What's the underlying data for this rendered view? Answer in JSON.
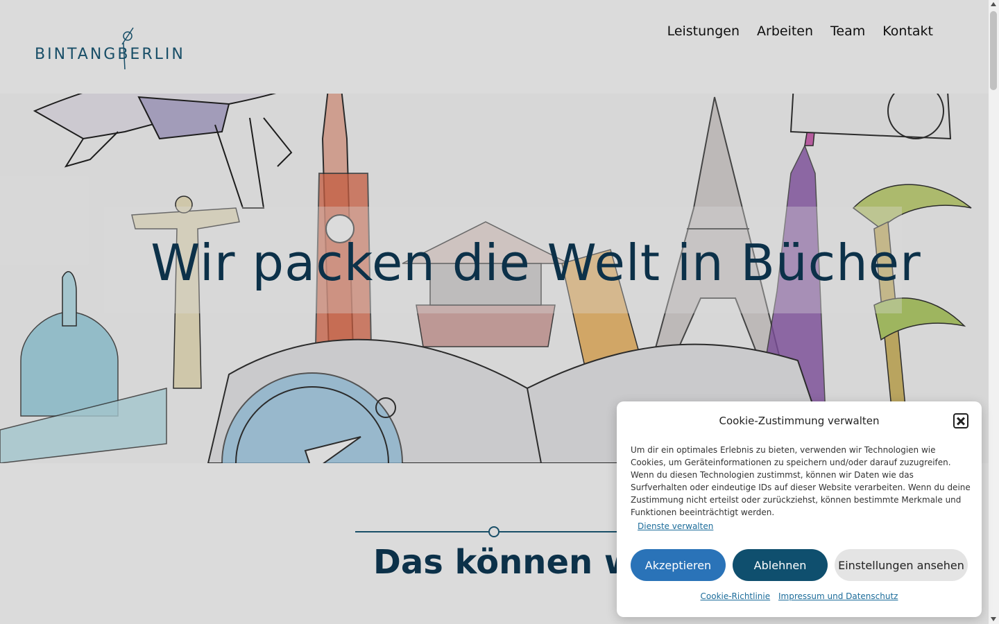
{
  "brand": {
    "part1": "BINTANG",
    "part2": "BERLIN"
  },
  "nav": [
    {
      "label": "Leistungen"
    },
    {
      "label": "Arbeiten"
    },
    {
      "label": "Team"
    },
    {
      "label": "Kontakt"
    }
  ],
  "hero": {
    "title": "Wir packen die Welt in Bücher"
  },
  "section": {
    "title": "Das können wir"
  },
  "cookie": {
    "title": "Cookie-Zustimmung verwalten",
    "text": "Um dir ein optimales Erlebnis zu bieten, verwenden wir Technologien wie Cookies, um Geräteinformationen zu speichern und/oder darauf zuzugreifen. Wenn du diesen Technologien zustimmst, können wir Daten wie das Surfverhalten oder eindeutige IDs auf dieser Website verarbeiten. Wenn du deine Zustimmung nicht erteilst oder zurückziehst, können bestimmte Merkmale und Funktionen beeinträchtigt werden.",
    "manage_link": "Dienste verwalten",
    "accept": "Akzeptieren",
    "deny": "Ablehnen",
    "settings": "Einstellungen ansehen",
    "policy_link": "Cookie-Richtlinie",
    "imprint_link": "Impressum und Datenschutz"
  },
  "colors": {
    "brand": "#1c5b78",
    "accent_button": "#2a73b8",
    "deny_button": "#0f4f6e",
    "title": "#0f3a55"
  }
}
